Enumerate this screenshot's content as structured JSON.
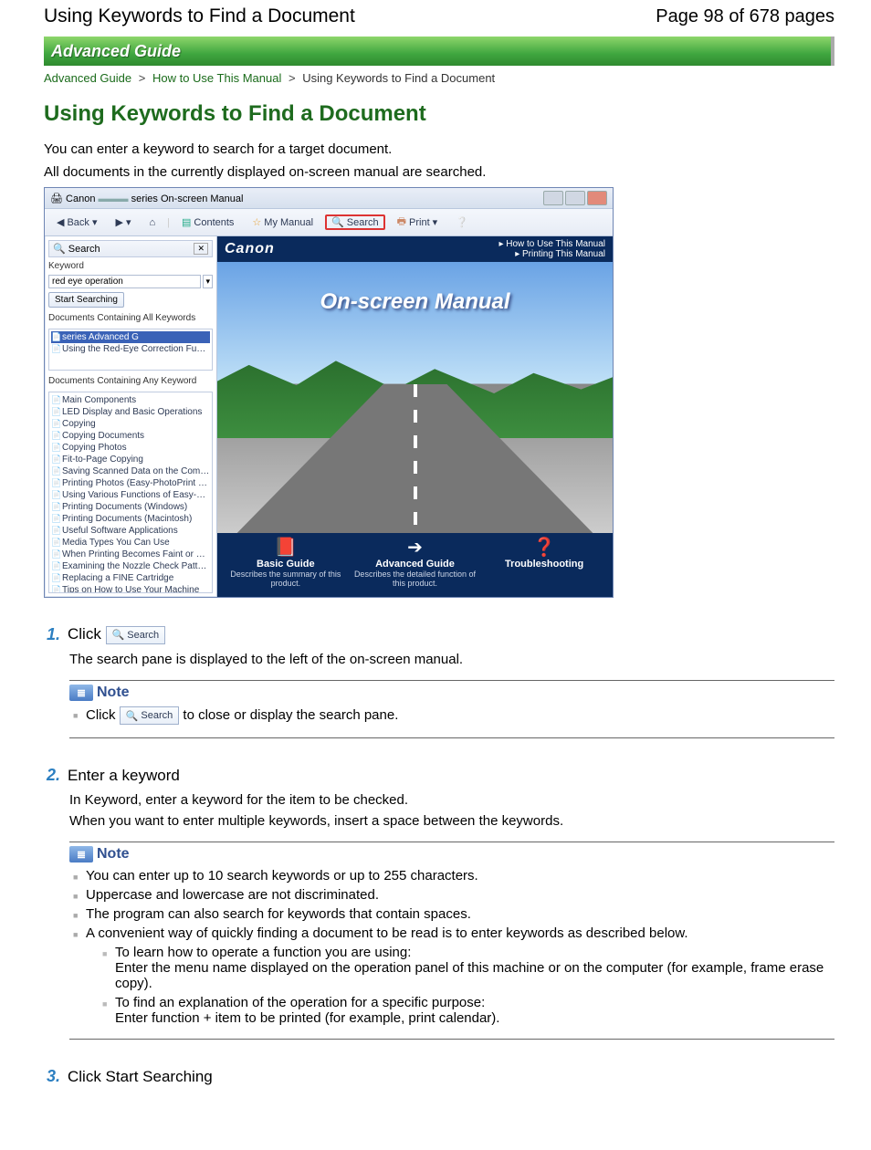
{
  "header": {
    "title": "Using Keywords to Find a Document",
    "page_indicator": "Page 98 of 678 pages"
  },
  "banner": {
    "text": "Advanced Guide"
  },
  "breadcrumb": {
    "items": [
      "Advanced Guide",
      "How to Use This Manual"
    ],
    "current": "Using Keywords to Find a Document",
    "sep": ">"
  },
  "doc_title": "Using Keywords to Find a Document",
  "intro": [
    "You can enter a keyword to search for a target document.",
    "All documents in the currently displayed on-screen manual are searched."
  ],
  "screenshot": {
    "window_title_prefix": "Canon",
    "window_title_suffix": "series On-screen Manual",
    "toolbar": {
      "back": "Back",
      "contents": "Contents",
      "my_manual": "My Manual",
      "search": "Search",
      "print": "Print"
    },
    "search_pane": {
      "title": "Search",
      "keyword_label": "Keyword",
      "keyword_value": "red eye operation",
      "start_button": "Start Searching",
      "all_title": "Documents Containing All Keywords",
      "all_items": [
        "series Advanced G",
        "Using the Red-Eye Correction Function"
      ],
      "any_title": "Documents Containing Any Keyword",
      "any_items": [
        "Main Components",
        "LED Display and Basic Operations",
        "Copying",
        "Copying Documents",
        "Copying Photos",
        "Fit-to-Page Copying",
        "Saving Scanned Data on the Computer",
        "Printing Photos (Easy-PhotoPrint EX)",
        "Using Various Functions of Easy-PhotoPrint",
        "Printing Documents (Windows)",
        "Printing Documents (Macintosh)",
        "Useful Software Applications",
        "Media Types You Can Use",
        "When Printing Becomes Faint or Colors Are",
        "Examining the Nozzle Check Pattern",
        "Replacing a FINE Cartridge",
        "Tips on How to Use Your Machine"
      ]
    },
    "main": {
      "brand": "Canon",
      "links": [
        "How to Use This Manual",
        "Printing This Manual"
      ],
      "hero_title": "On-screen Manual",
      "guides": [
        {
          "icon": "📕",
          "title": "Basic Guide",
          "desc": "Describes the summary of this product."
        },
        {
          "icon": "➔",
          "title": "Advanced Guide",
          "desc": "Describes the detailed function of this product."
        },
        {
          "icon": "❓",
          "title": "Troubleshooting",
          "desc": ""
        }
      ]
    }
  },
  "steps": {
    "s1": {
      "num": "1.",
      "prefix": "Click ",
      "chip": "Search",
      "body": "The search pane is displayed to the left of the on-screen manual.",
      "note_label": "Note",
      "note_prefix": "Click ",
      "note_suffix": " to close or display the search pane."
    },
    "s2": {
      "num": "2.",
      "title": "Enter a keyword",
      "body1": "In Keyword, enter a keyword for the item to be checked.",
      "body2": "When you want to enter multiple keywords, insert a space between the keywords.",
      "note_label": "Note",
      "notes": [
        "You can enter up to 10 search keywords or up to 255 characters.",
        "Uppercase and lowercase are not discriminated.",
        "The program can also search for keywords that contain spaces.",
        "A convenient way of quickly finding a document to be read is to enter keywords as described below."
      ],
      "sub": [
        {
          "head": "To learn how to operate a function you are using:",
          "body": "Enter the menu name displayed on the operation panel of this machine or on the computer (for example, frame erase copy)."
        },
        {
          "head": "To find an explanation of the operation for a specific purpose:",
          "body": "Enter function + item to be printed (for example, print calendar)."
        }
      ]
    },
    "s3": {
      "num": "3.",
      "title": "Click Start Searching"
    }
  }
}
